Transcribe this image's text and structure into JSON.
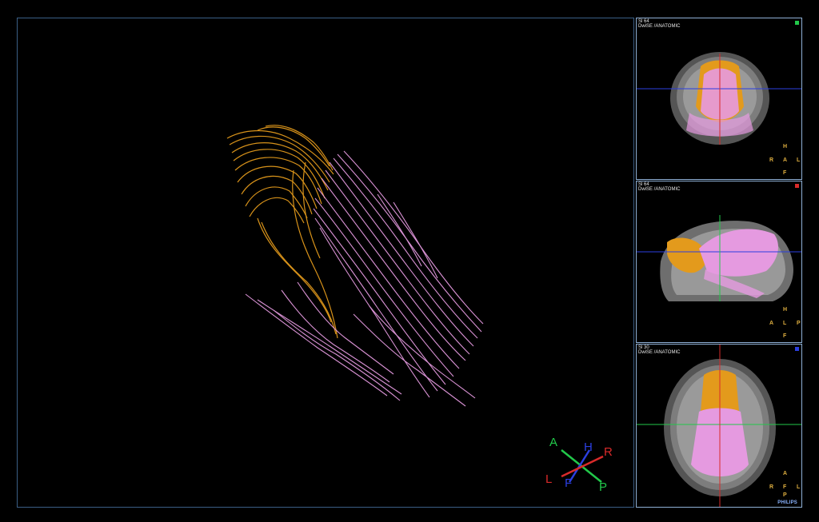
{
  "main_view": {
    "orientation_triad": {
      "a_label": "A",
      "h_label": "H",
      "r_label": "R",
      "l_label": "L",
      "f_label": "F",
      "p_label": "P",
      "colors": {
        "ap": "#22c84a",
        "hf": "#2b3fe0",
        "rl": "#d92a2a"
      }
    }
  },
  "panels": [
    {
      "slice": "Sl 64",
      "series": "DwiSE  /ANATOMIC",
      "marker_color": "#22c84a",
      "orient": {
        "top": "H",
        "left": "R",
        "center": "A",
        "right": "L",
        "bottom": "F"
      }
    },
    {
      "slice": "Sl 64",
      "series": "DwiSE  /ANATOMIC",
      "marker_color": "#d92a2a",
      "orient": {
        "top": "H",
        "left": "A",
        "center": "L",
        "right": "P",
        "bottom": "F"
      }
    },
    {
      "slice": "Sl 30",
      "series": "DwiSE  /ANATOMIC",
      "marker_color": "#2b3fe0",
      "orient": {
        "top": "A",
        "left": "R",
        "center": "F",
        "right": "L",
        "bottom": "P"
      }
    }
  ],
  "brand": "PHILIPS",
  "colors": {
    "tract_orange": "#e39a1c",
    "tract_pink": "#e59ae0",
    "frame": "#3b5f86"
  }
}
